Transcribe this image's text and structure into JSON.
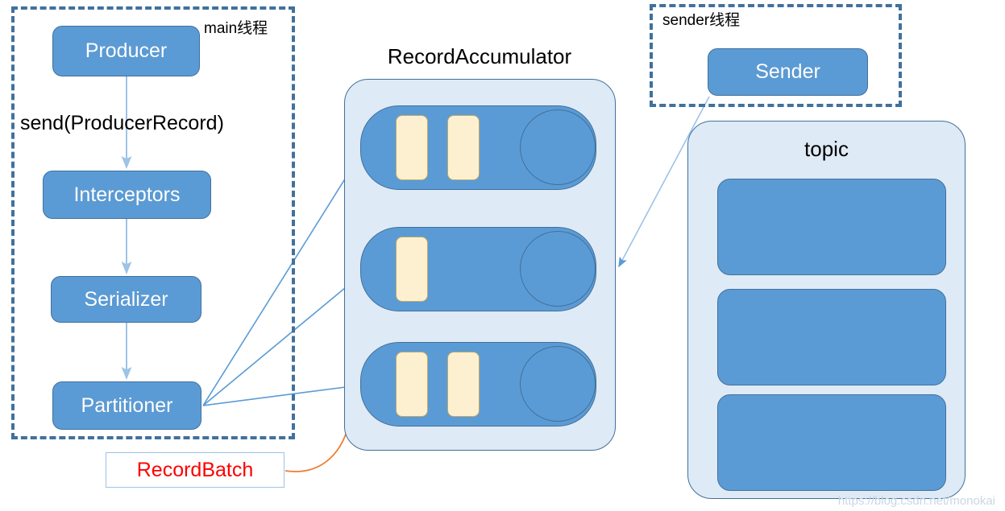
{
  "diagram": {
    "title_accumulator": "RecordAccumulator",
    "title_topic": "topic",
    "watermark": "https://blog.csdn.net/monokai"
  },
  "main_thread": {
    "label": "main线程",
    "send_label": "send(ProducerRecord)",
    "stages": [
      {
        "id": "producer",
        "label": "Producer"
      },
      {
        "id": "interceptors",
        "label": "Interceptors"
      },
      {
        "id": "serializer",
        "label": "Serializer"
      },
      {
        "id": "partitioner",
        "label": "Partitioner"
      }
    ]
  },
  "sender_thread": {
    "label": "sender线程",
    "stages": [
      {
        "id": "sender",
        "label": "Sender"
      }
    ]
  },
  "callout": {
    "record_batch_label": "RecordBatch"
  },
  "accumulator": {
    "deques": [
      {
        "id": "deque-0",
        "batch_count": 2
      },
      {
        "id": "deque-1",
        "batch_count": 1
      },
      {
        "id": "deque-2",
        "batch_count": 2
      }
    ]
  },
  "topic": {
    "partitions": [
      {
        "id": "partition-0"
      },
      {
        "id": "partition-1"
      },
      {
        "id": "partition-2"
      }
    ]
  },
  "colors": {
    "box_blue": "#5B9BD5",
    "box_border": "#41719C",
    "container_blue": "#DEEAF6",
    "batch_cream": "#FDF0D0",
    "frame_dash": "#41719C",
    "arrow_blue": "#5B9BD5",
    "arrow_orange": "#ED7D31",
    "record_batch_text": "#FF0000",
    "callout_border": "#9DC3E6",
    "watermark": "#C9D7E4"
  }
}
